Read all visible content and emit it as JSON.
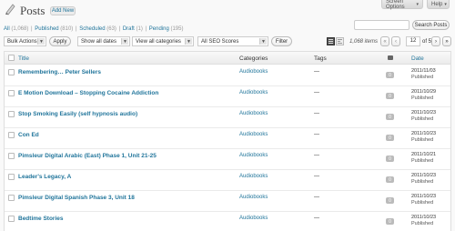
{
  "header": {
    "title": "Posts",
    "add_new": "Add New",
    "screen_options": "Screen Options",
    "help": "Help"
  },
  "filters": {
    "all": "All",
    "all_count": "(1,068)",
    "published": "Published",
    "published_count": "(810)",
    "scheduled": "Scheduled",
    "scheduled_count": "(63)",
    "draft": "Draft",
    "draft_count": "(1)",
    "pending": "Pending",
    "pending_count": "(195)",
    "sep": "|"
  },
  "search": {
    "button": "Search Posts",
    "value": ""
  },
  "toolbar": {
    "bulk_actions": "Bulk Actions",
    "apply": "Apply",
    "dates": "Show all dates",
    "categories": "View all categories",
    "seo": "All SEO Scores",
    "filter": "Filter",
    "items": "1,068 items",
    "first": "«",
    "prev": "‹",
    "page": "12",
    "of_pages": "of 54",
    "next": "›",
    "last": "»"
  },
  "columns": {
    "title": "Title",
    "categories": "Categories",
    "tags": "Tags",
    "date": "Date"
  },
  "rows": [
    {
      "title": "Remembering… Peter Sellers",
      "category": "Audiobooks",
      "tags": "—",
      "comments": "0",
      "date": "2011/11/03",
      "status": "Published"
    },
    {
      "title": "E Motion Download – Stopping Cocaine Addiction",
      "category": "Audiobooks",
      "tags": "—",
      "comments": "0",
      "date": "2011/10/29",
      "status": "Published"
    },
    {
      "title": "Stop Smoking Easily (self hypnosis audio)",
      "category": "Audiobooks",
      "tags": "—",
      "comments": "0",
      "date": "2011/10/23",
      "status": "Published"
    },
    {
      "title": "Con Ed",
      "category": "Audiobooks",
      "tags": "—",
      "comments": "0",
      "date": "2011/10/23",
      "status": "Published"
    },
    {
      "title": "Pimsleur Digital Arabic (East) Phase 1, Unit 21-25",
      "category": "Audiobooks",
      "tags": "—",
      "comments": "0",
      "date": "2011/10/21",
      "status": "Published"
    },
    {
      "title": "Leader's Legacy, A",
      "category": "Audiobooks",
      "tags": "—",
      "comments": "0",
      "date": "2011/10/23",
      "status": "Published"
    },
    {
      "title": "Pimsleur Digital Spanish Phase 3, Unit 18",
      "category": "Audiobooks",
      "tags": "—",
      "comments": "0",
      "date": "2011/10/23",
      "status": "Published"
    },
    {
      "title": "Bedtime Stories",
      "category": "Audiobooks",
      "tags": "—",
      "comments": "0",
      "date": "2011/10/23",
      "status": "Published"
    }
  ]
}
